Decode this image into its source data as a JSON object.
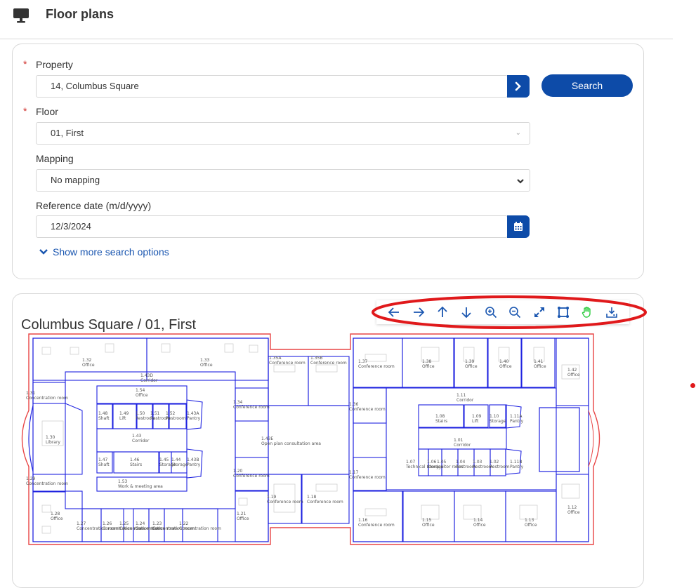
{
  "header": {
    "title": "Floor plans",
    "icon": "monitor-icon"
  },
  "search": {
    "property_label": "Property",
    "property_value": "14, Columbus Square",
    "floor_label": "Floor",
    "floor_value": "01, First",
    "mapping_label": "Mapping",
    "mapping_value": "No mapping",
    "date_label": "Reference date (m/d/yyyy)",
    "date_value": "12/3/2024",
    "search_button": "Search",
    "more_options": "Show more search options",
    "required_mark": "*"
  },
  "plan": {
    "title": "Columbus Square / 01, First",
    "toolbar": [
      "arrow-left-icon",
      "arrow-right-icon",
      "arrow-up-icon",
      "arrow-down-icon",
      "zoom-in-icon",
      "zoom-out-icon",
      "fit-icon",
      "select-area-icon",
      "pan-hand-icon",
      "download-icon"
    ],
    "pan_active_color": "#2ecc40",
    "accent_color": "#0d4ba8",
    "annotation_color": "#e0191b",
    "rooms": [
      {
        "id": "1.32",
        "name": "Office"
      },
      {
        "id": "1.33",
        "name": "Office"
      },
      {
        "id": "1.43D",
        "name": "Corridor"
      },
      {
        "id": "1.54",
        "name": "Office"
      },
      {
        "id": "1.31",
        "name": "Concentration room"
      },
      {
        "id": "1.48",
        "name": "Shaft"
      },
      {
        "id": "1.49",
        "name": "Lift"
      },
      {
        "id": "1.50",
        "name": "Restroom"
      },
      {
        "id": "1.51",
        "name": "Restroom"
      },
      {
        "id": "1.52",
        "name": "Restroom"
      },
      {
        "id": "1.43A",
        "name": "Pantry"
      },
      {
        "id": "1.30",
        "name": "Library"
      },
      {
        "id": "1.43",
        "name": "Corridor"
      },
      {
        "id": "1.47",
        "name": "Shaft"
      },
      {
        "id": "1.46",
        "name": "Stairs"
      },
      {
        "id": "1.45",
        "name": "Storage"
      },
      {
        "id": "1.44",
        "name": "Storage"
      },
      {
        "id": "1.43B",
        "name": "Pantry"
      },
      {
        "id": "1.53",
        "name": "Work & meeting area"
      },
      {
        "id": "1.29",
        "name": "Concentration room"
      },
      {
        "id": "1.28",
        "name": "Office"
      },
      {
        "id": "1.27",
        "name": "Concentration room"
      },
      {
        "id": "1.26",
        "name": "Concentration room"
      },
      {
        "id": "1.25",
        "name": "Concentration room"
      },
      {
        "id": "1.24",
        "name": "Concentration room"
      },
      {
        "id": "1.23",
        "name": "Concentration room"
      },
      {
        "id": "1.22",
        "name": "Concentration room"
      },
      {
        "id": "1.21",
        "name": "Office"
      },
      {
        "id": "1.35A",
        "name": "Conference room"
      },
      {
        "id": "1.35B",
        "name": "Conference room"
      },
      {
        "id": "1.34",
        "name": "Conference room"
      },
      {
        "id": "1.43E",
        "name": "Open plan consultation area"
      },
      {
        "id": "1.20",
        "name": "Conference room"
      },
      {
        "id": "1.19",
        "name": "Conference room"
      },
      {
        "id": "1.18",
        "name": "Conference room"
      },
      {
        "id": "1.37",
        "name": "Conference room"
      },
      {
        "id": "1.38",
        "name": "Office"
      },
      {
        "id": "1.39",
        "name": "Office"
      },
      {
        "id": "1.40",
        "name": "Office"
      },
      {
        "id": "1.41",
        "name": "Office"
      },
      {
        "id": "1.42",
        "name": "Office"
      },
      {
        "id": "1.36",
        "name": "Conference room"
      },
      {
        "id": "1.11",
        "name": "Corridor"
      },
      {
        "id": "1.08",
        "name": "Stairs"
      },
      {
        "id": "1.09",
        "name": "Lift"
      },
      {
        "id": "1.10",
        "name": "Storage"
      },
      {
        "id": "1.11A",
        "name": "Pantry"
      },
      {
        "id": "1.01",
        "name": "Corridor"
      },
      {
        "id": "1.07",
        "name": "Technical room"
      },
      {
        "id": "1.06",
        "name": "Storage"
      },
      {
        "id": "1.05",
        "name": "Janitor room"
      },
      {
        "id": "1.04",
        "name": "Restroom"
      },
      {
        "id": "1.03",
        "name": "Restroom"
      },
      {
        "id": "1.02",
        "name": "Restroom"
      },
      {
        "id": "1.11B",
        "name": "Pantry"
      },
      {
        "id": "1.17",
        "name": "Conference room"
      },
      {
        "id": "1.16",
        "name": "Conference room"
      },
      {
        "id": "1.15",
        "name": "Office"
      },
      {
        "id": "1.14",
        "name": "Office"
      },
      {
        "id": "1.13",
        "name": "Office"
      },
      {
        "id": "1.12",
        "name": "Office"
      }
    ]
  }
}
